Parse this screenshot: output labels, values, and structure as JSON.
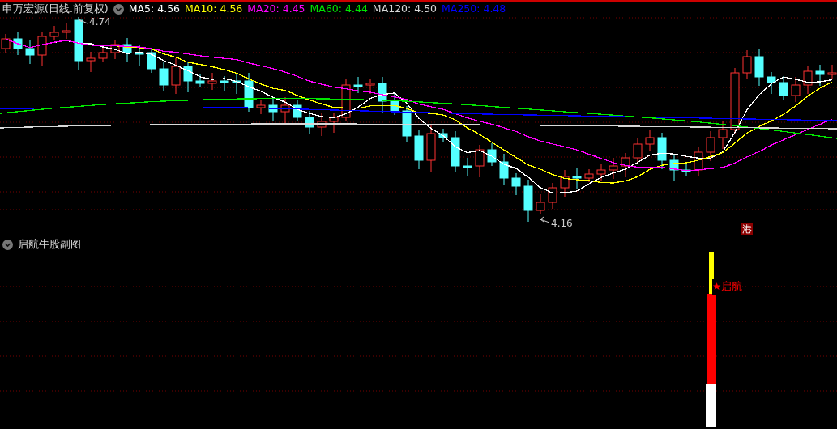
{
  "main_pane": {
    "title": "申万宏源(日线.前复权)",
    "indicators": [
      {
        "label": "MA5: 4.56",
        "color": "#ffffff"
      },
      {
        "label": "MA10: 4.56",
        "color": "#ffff00"
      },
      {
        "label": "MA20: 4.45",
        "color": "#ff00ff"
      },
      {
        "label": "MA60: 4.44",
        "color": "#00e600"
      },
      {
        "label": "MA120: 4.50",
        "color": "#d8d8d8"
      },
      {
        "label": "MA250: 4.48",
        "color": "#0000ff"
      }
    ],
    "high_label": "4.74",
    "low_label": "4.16",
    "badge": "港"
  },
  "sub_pane": {
    "title": "启航牛股副图",
    "signal_label": "★启航"
  }
}
